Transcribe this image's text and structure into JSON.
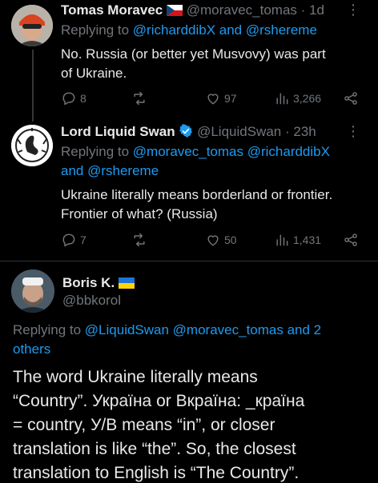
{
  "tweets": [
    {
      "name": "Tomas Moravec",
      "handle": "@moravec_tomas",
      "time": "· 1d",
      "reply_prefix": "Replying to",
      "reply_mentions": "@richarddibX and @rshereme",
      "body_lines": [
        "No. Russia (or better yet Musvovy) was part",
        "of Ukraine."
      ],
      "replies": "8",
      "likes": "97",
      "views": "3,266"
    },
    {
      "name": "Lord Liquid Swan",
      "handle": "@LiquidSwan",
      "time": "· 23h",
      "reply_prefix": "Replying to",
      "reply_line1": "@moravec_tomas @richarddibX",
      "reply_line2": "and @rshereme",
      "body_lines": [
        "Ukraine literally means borderland or frontier.",
        "Frontier of what? (Russia)"
      ],
      "replies": "7",
      "likes": "50",
      "views": "1,431"
    },
    {
      "name": "Boris K.",
      "handle": "@bbkorol",
      "reply_prefix": "Replying to",
      "reply_line1": "@LiquidSwan @moravec_tomas and 2",
      "reply_line2": "others",
      "body_lines": [
        "The word Ukraine literally means",
        "“Country”. Україна or Вкраїна: _країна",
        "= country, У/В means “in”, or closer",
        "translation is like “the”. So, the closest",
        "translation to English is “The Country”."
      ]
    }
  ],
  "more_label": "⋮",
  "colors": {
    "background": "#000000",
    "text": "#e7e9ea",
    "muted": "#71767b",
    "link": "#1d9bf0",
    "verified": "#1d9bf0"
  },
  "icons": [
    "reply-icon",
    "retweet-icon",
    "like-icon",
    "views-icon",
    "share-icon",
    "verified-icon",
    "czech-flag-icon",
    "ukraine-flag-icon",
    "more-icon"
  ]
}
